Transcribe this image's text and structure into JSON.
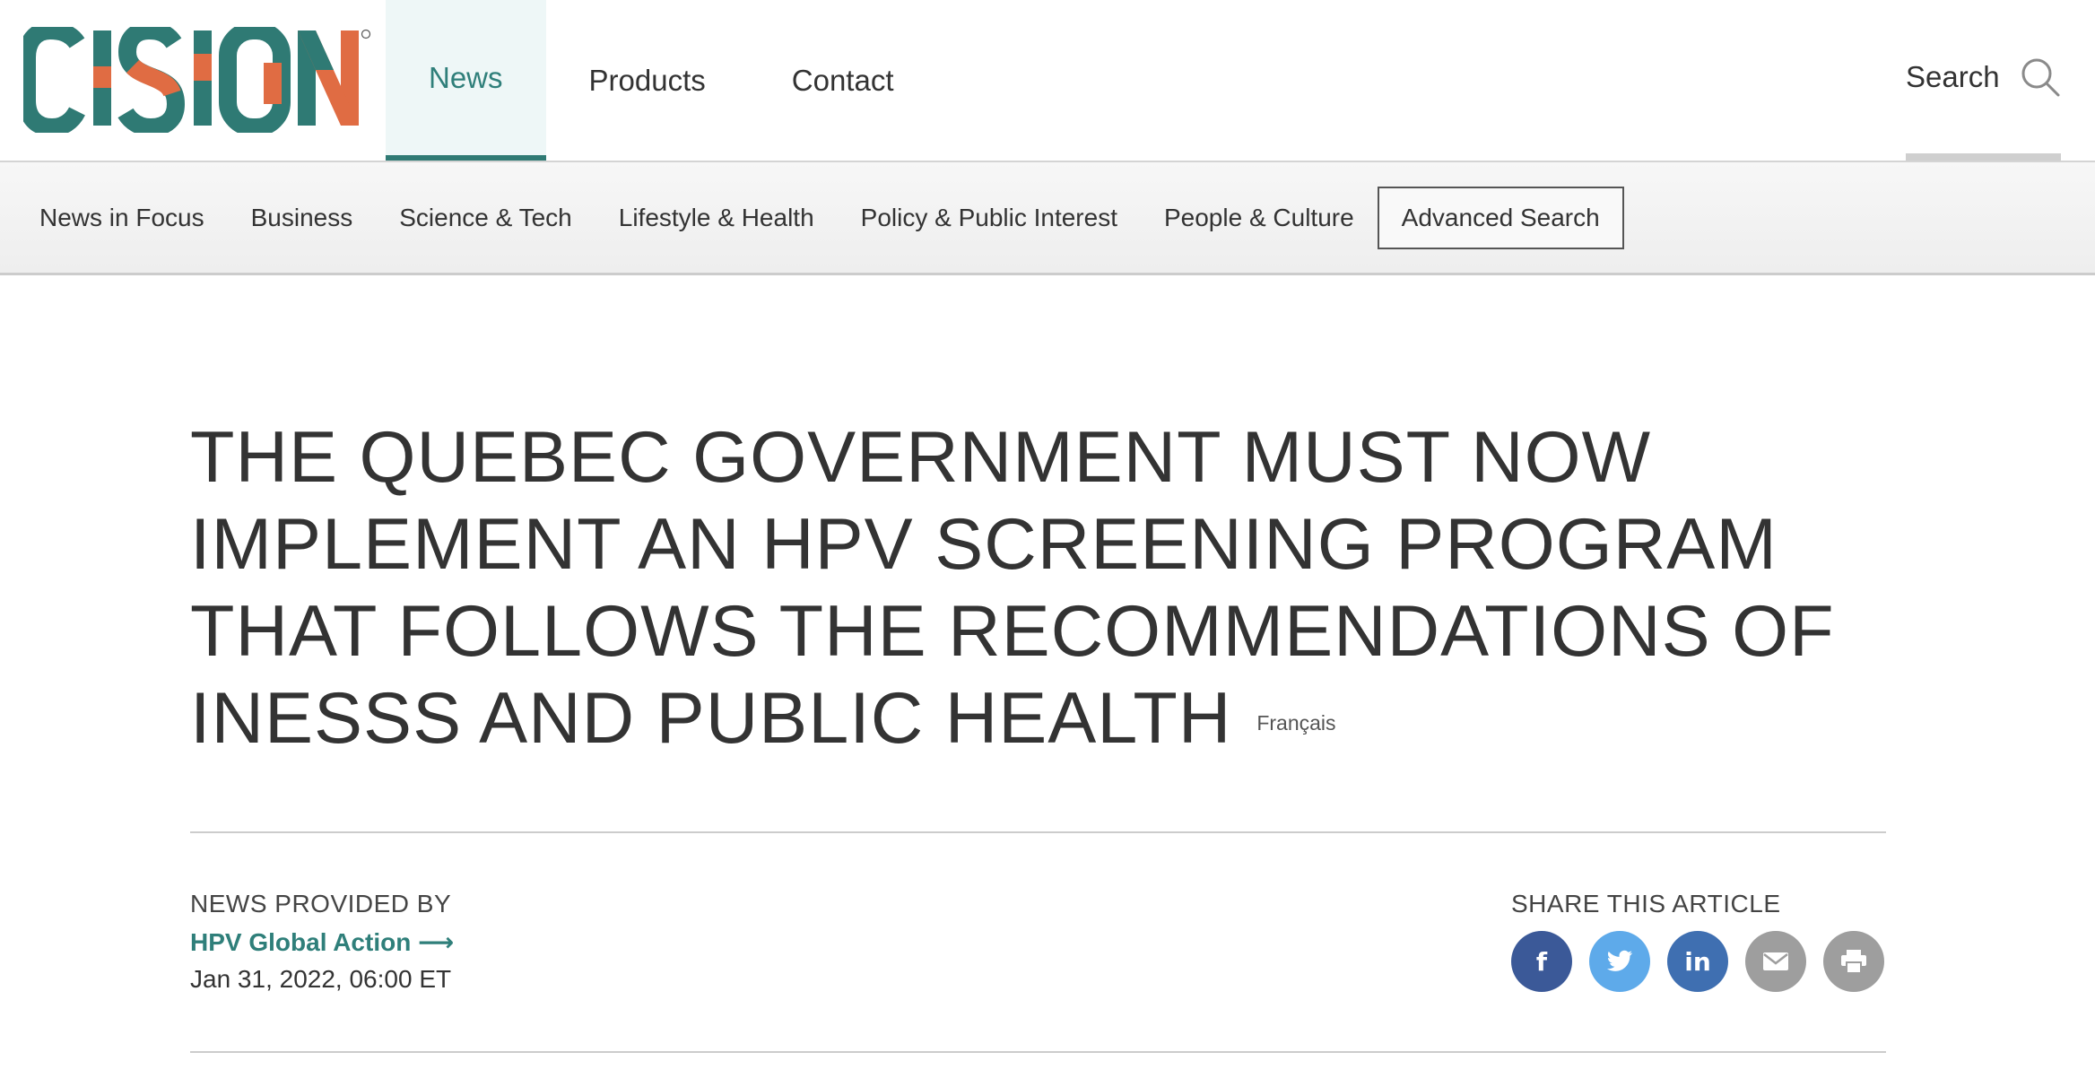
{
  "brand": {
    "logo_text": "CISION",
    "colors": {
      "teal": "#2f7a74",
      "orange": "#e06c43"
    }
  },
  "main_nav": {
    "items": [
      {
        "label": "News",
        "active": true
      },
      {
        "label": "Products",
        "active": false
      },
      {
        "label": "Contact",
        "active": false
      }
    ]
  },
  "search": {
    "label": "Search",
    "icon": "search-icon"
  },
  "sub_nav": {
    "items": [
      {
        "label": "News in Focus"
      },
      {
        "label": "Business"
      },
      {
        "label": "Science & Tech"
      },
      {
        "label": "Lifestyle & Health"
      },
      {
        "label": "Policy & Public Interest"
      },
      {
        "label": "People & Culture"
      }
    ],
    "advanced_search_label": "Advanced Search"
  },
  "article": {
    "headline": "THE QUEBEC GOVERNMENT MUST NOW IMPLEMENT AN HPV SCREENING PROGRAM THAT FOLLOWS THE RECOMMENDATIONS OF INESSS AND PUBLIC HEALTH",
    "language_link": "Français",
    "provided_by_label": "NEWS PROVIDED BY",
    "provider": "HPV Global Action",
    "provider_arrow": "⟶",
    "date": "Jan 31, 2022, 06:00 ET"
  },
  "share": {
    "label": "SHARE THIS ARTICLE",
    "buttons": [
      {
        "name": "facebook",
        "icon": "facebook-icon",
        "glyph": "f",
        "color": "#3b5998"
      },
      {
        "name": "twitter",
        "icon": "twitter-icon",
        "glyph": "",
        "color": "#5eaaea"
      },
      {
        "name": "linkedin",
        "icon": "linkedin-icon",
        "glyph": "in",
        "color": "#3f6fb1"
      },
      {
        "name": "email",
        "icon": "email-icon",
        "glyph": "",
        "color": "#9e9e9e"
      },
      {
        "name": "print",
        "icon": "print-icon",
        "glyph": "",
        "color": "#9e9e9e"
      }
    ]
  }
}
